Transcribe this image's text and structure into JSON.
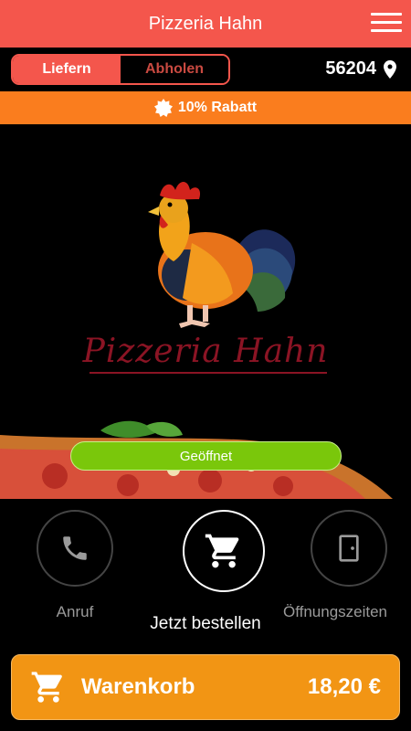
{
  "header": {
    "title": "Pizzeria Hahn"
  },
  "mode": {
    "options": [
      "Liefern",
      "Abholen"
    ],
    "active": "Liefern"
  },
  "location": {
    "zip": "56204"
  },
  "promo": {
    "text": "10% Rabatt"
  },
  "hero": {
    "brand_name": "Pizzeria Hahn",
    "status": "Geöffnet"
  },
  "actions": [
    {
      "label": "Anruf",
      "icon": "phone-icon"
    },
    {
      "label": "Jetzt bestellen",
      "icon": "cart-icon"
    },
    {
      "label": "Öffnungszeiten",
      "icon": "door-icon"
    }
  ],
  "cart": {
    "label": "Warenkorb",
    "total": "18,20 €"
  },
  "colors": {
    "header": "#f4564c",
    "promo": "#fa7d1e",
    "status": "#7ac70b",
    "cart": "#f29514",
    "brand": "#8b1424"
  }
}
